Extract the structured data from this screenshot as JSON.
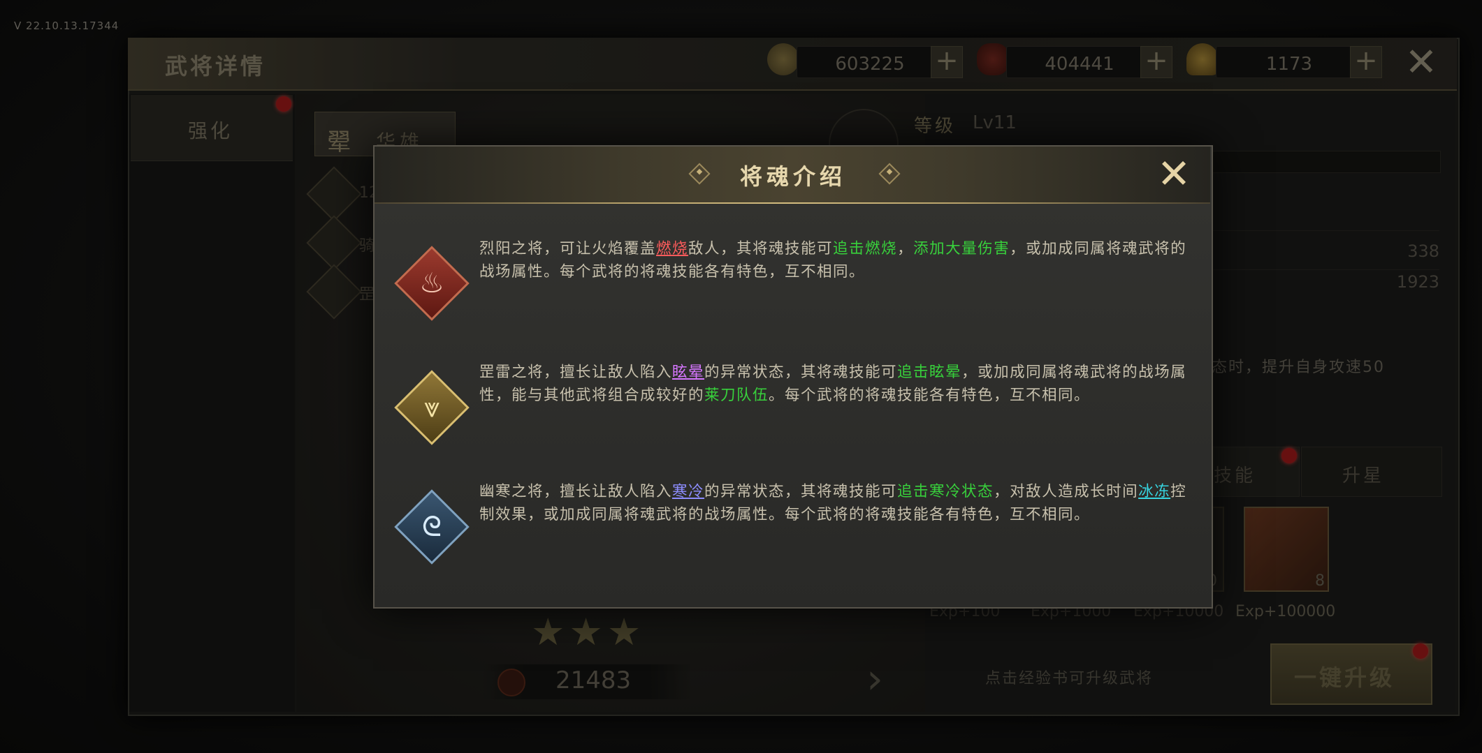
{
  "version": "V 22.10.13.17344",
  "window": {
    "title": "武将详情",
    "close_icon": "close-icon"
  },
  "resources": [
    {
      "name": "copper-coin",
      "value": "603225",
      "icon": "coin-icon",
      "color": "#8a7a48"
    },
    {
      "name": "food",
      "value": "404441",
      "icon": "food-bag-icon",
      "color": "#7a2a20"
    },
    {
      "name": "gold-ingot",
      "value": "1173",
      "icon": "ingot-icon",
      "color": "#b08f3a"
    }
  ],
  "left_tabs": {
    "strengthen": "强化"
  },
  "hero": {
    "badge": "翚",
    "name": "华雄",
    "side_items": [
      "12",
      "骑",
      "罡"
    ],
    "stars": "★★★",
    "power": "21483"
  },
  "right_panel": {
    "level_label": "等级",
    "level_value": "Lv11",
    "stats": [
      "338",
      "1923"
    ],
    "passive_text": "状态时，提升自身攻速50",
    "tabs": {
      "skill": "技能",
      "upstar": "升星"
    },
    "books": [
      {
        "count": "",
        "exp": "Exp+100"
      },
      {
        "count": "",
        "exp": "Exp+1000"
      },
      {
        "count": "0",
        "exp": "Exp+10000"
      },
      {
        "count": "8",
        "exp": "Exp+100000"
      }
    ],
    "hint": "点击经验书可升级武将",
    "onekey_label": "一键升级"
  },
  "modal": {
    "title": "将魂介绍",
    "items": [
      {
        "icon": "fire-soul-icon",
        "glyph": "♨",
        "t1": "烈阳之将，可让火焰覆盖",
        "h1": "燃烧",
        "t2": "敌人，其将魂技能可",
        "h2": "追击燃烧",
        "t3": "，",
        "h3": "添加大量伤害",
        "t4": "，或加成同属将魂武将的战场属性。每个武将的将魂技能各有特色，互不相同。"
      },
      {
        "icon": "thunder-soul-icon",
        "glyph": "⩔",
        "t1": "罡雷之将，擅长让敌人陷入",
        "h1": "眩晕",
        "t2": "的异常状态，其将魂技能可",
        "h2": "追击眩晕",
        "t3": "，或加成同属将魂武将的战场属性，能与其他武将组合成较好的",
        "h3": "莱刀队伍",
        "t4": "。每个武将的将魂技能各有特色，互不相同。"
      },
      {
        "icon": "frost-soul-icon",
        "glyph": "ᘓ",
        "t1": "幽寒之将，擅长让敌人陷入",
        "h1": "寒冷",
        "t2": "的异常状态，其将魂技能可",
        "h2": "追击寒冷状态",
        "t3": "，对敌人造成长时间",
        "h3": "冰冻",
        "t4": "控制效果，或加成同属将魂武将的战场属性。每个武将的将魂技能各有特色，互不相同。"
      }
    ]
  }
}
